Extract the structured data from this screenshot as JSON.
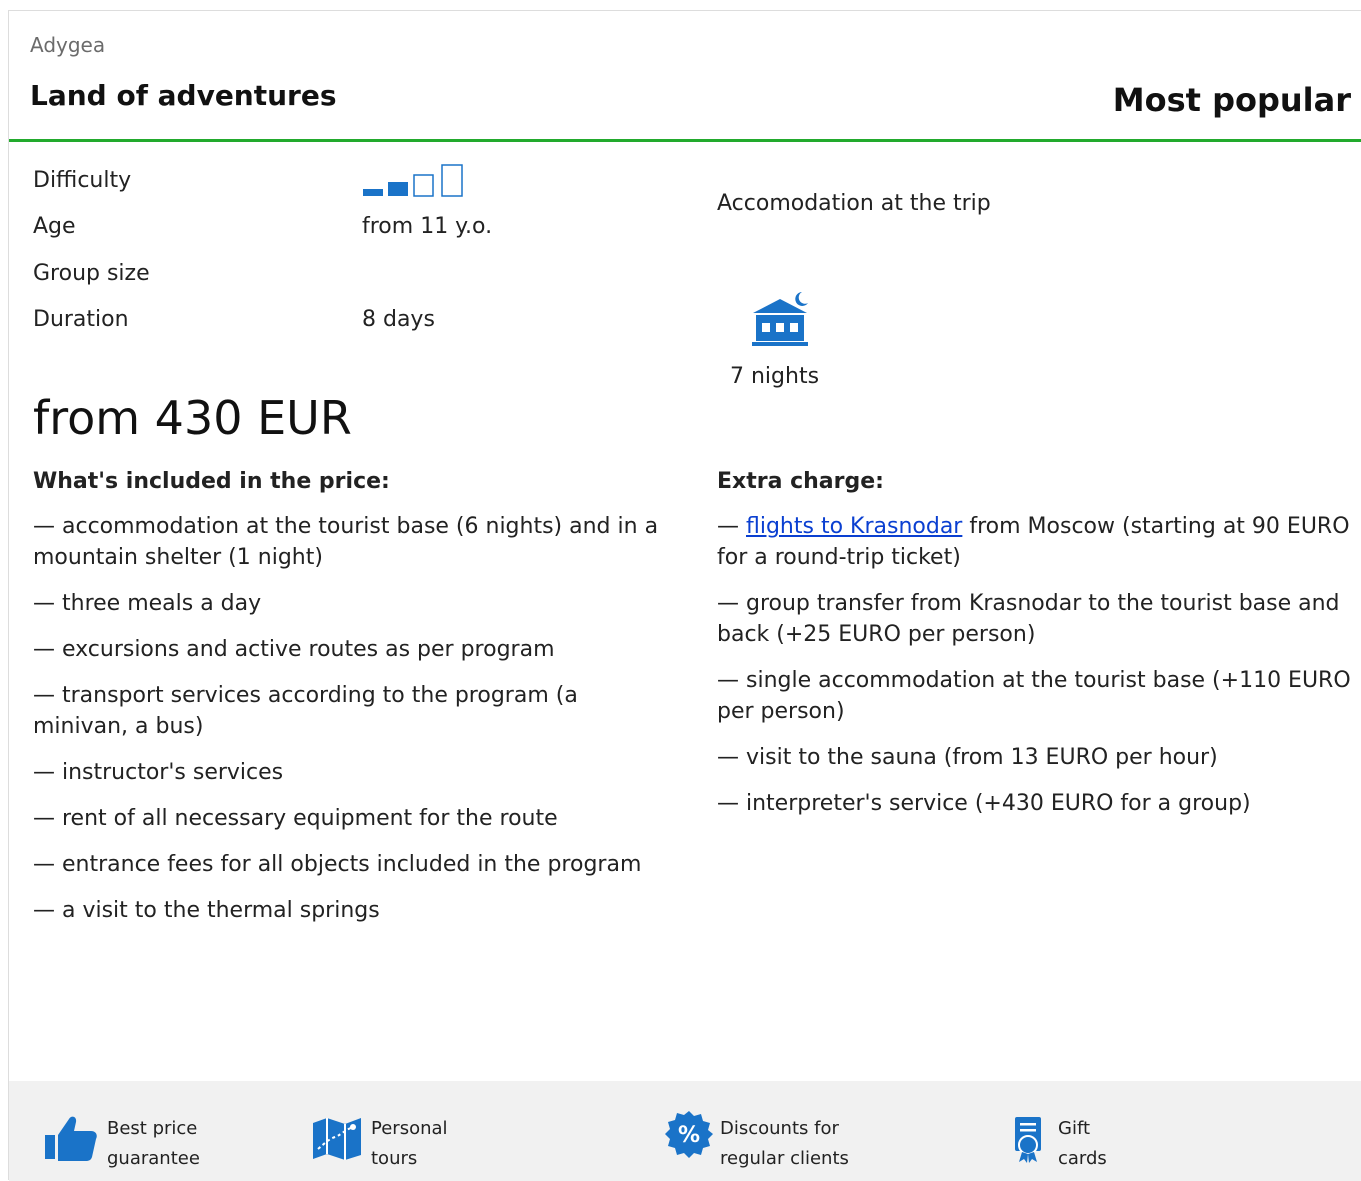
{
  "header": {
    "region": "Adygea",
    "title": "Land of adventures",
    "badge": "Most popular"
  },
  "params": {
    "difficulty_label": "Difficulty",
    "difficulty_level": 2,
    "difficulty_max": 4,
    "age_label": "Age",
    "age_value": "from 11 y.o.",
    "group_label": "Group size",
    "group_value": "",
    "duration_label": "Duration",
    "duration_value": "8 days"
  },
  "accommodation": {
    "title": "Accomodation at the trip",
    "icon": "house-night-icon",
    "nights": "7 nights"
  },
  "price": "from 430 EUR",
  "included": {
    "title": "What's included in the price:",
    "items": [
      "— accommodation at the tourist base (6 nights) and in a mountain shelter (1 night)",
      "— three meals a day",
      "— excursions and active routes as per program",
      "— transport services according to the program (a minivan, a bus)",
      "— instructor's services",
      "— rent of all necessary equipment for the route",
      "— entrance fees for all objects included in the program",
      "— a visit to the thermal springs"
    ]
  },
  "extra": {
    "title": "Extra charge:",
    "first_prefix": "— ",
    "first_link": "flights to Krasnodar",
    "first_suffix": " from Moscow (starting at 90 EURO for a round-trip ticket)",
    "items": [
      "— group transfer from Krasnodar to the tourist base and back (+25 EURO per person)",
      "— single accommodation at the tourist base (+110 EURO per person)",
      "— visit to the sauna (from 13 EURO per hour)",
      "— interpreter's service (+430 EURO for a group)"
    ]
  },
  "footer": [
    {
      "icon": "thumbs-up-icon",
      "label": "Best price\nguarantee"
    },
    {
      "icon": "map-icon",
      "label": "Personal\ntours"
    },
    {
      "icon": "discount-badge-icon",
      "label": "Discounts for\nregular clients"
    },
    {
      "icon": "gift-card-icon",
      "label": "Gift\ncards"
    }
  ],
  "colors": {
    "accent_green": "#22aa2d",
    "icon_blue": "#1a73c8",
    "footer_bg": "#f1f1f1",
    "link": "#0a3fd1"
  }
}
